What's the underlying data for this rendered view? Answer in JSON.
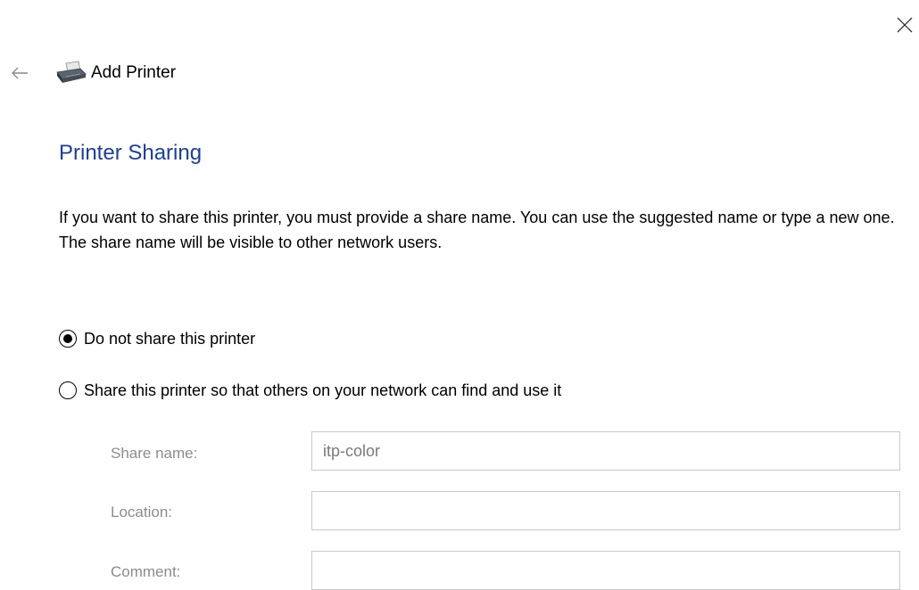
{
  "window": {
    "title": "Add Printer",
    "close_icon": "close-icon",
    "back_icon": "back-arrow-icon",
    "app_icon": "printer-icon"
  },
  "page": {
    "heading": "Printer Sharing",
    "description": "If you want to share this printer, you must provide a share name. You can use the suggested name or type a new one. The share name will be visible to other network users."
  },
  "sharing_options": [
    {
      "label": "Do not share this printer",
      "selected": true
    },
    {
      "label": "Share this printer so that others on your network can find and use it",
      "selected": false
    }
  ],
  "fields": {
    "share_name": {
      "label": "Share name:",
      "value": "itp-color"
    },
    "location": {
      "label": "Location:",
      "value": ""
    },
    "comment": {
      "label": "Comment:",
      "value": ""
    }
  },
  "colors": {
    "heading": "#1a3f9c",
    "disabled_label": "#8c8c8c",
    "input_border": "#c9c9c9"
  }
}
